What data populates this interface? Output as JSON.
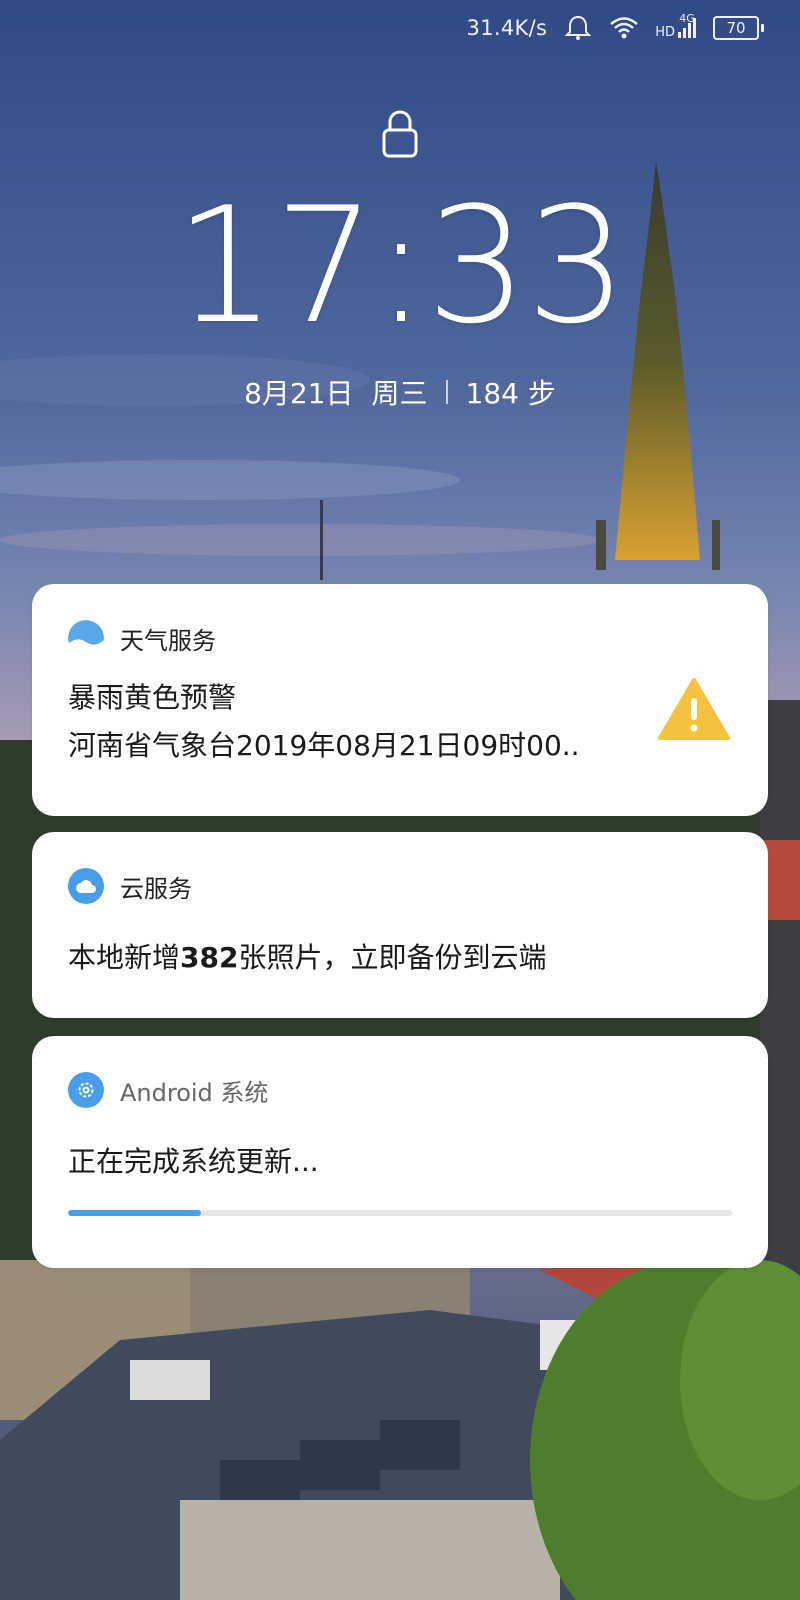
{
  "statusbar": {
    "net_speed": "31.4K/s",
    "hd_label": "HD",
    "network_type": "4G",
    "battery_level": "70",
    "icons": [
      "alarm-bell-icon",
      "wifi-icon",
      "cellular-signal-icon",
      "battery-icon"
    ]
  },
  "lockscreen": {
    "lock_icon": "lock-icon",
    "time": "17:33",
    "date": "8月21日",
    "weekday": "周三",
    "steps": "184 步"
  },
  "notifications": [
    {
      "app_name": "天气服务",
      "icon": "weather-icon",
      "title": "暴雨黄色预警",
      "text": "河南省气象台2019年08月21日09时00..",
      "badge_icon": "warning-triangle-icon",
      "badge_color": "#f5c23d"
    },
    {
      "app_name": "云服务",
      "icon": "cloud-icon",
      "text_prefix": "本地新增",
      "text_bold": "382",
      "text_suffix": "张照片，立即备份到云端"
    },
    {
      "app_name": "Android 系统",
      "icon": "gear-icon",
      "text": "正在完成系统更新...",
      "progress": 0.2
    }
  ],
  "colors": {
    "accent_blue": "#4a9de8",
    "warning_yellow": "#f5c23d"
  }
}
